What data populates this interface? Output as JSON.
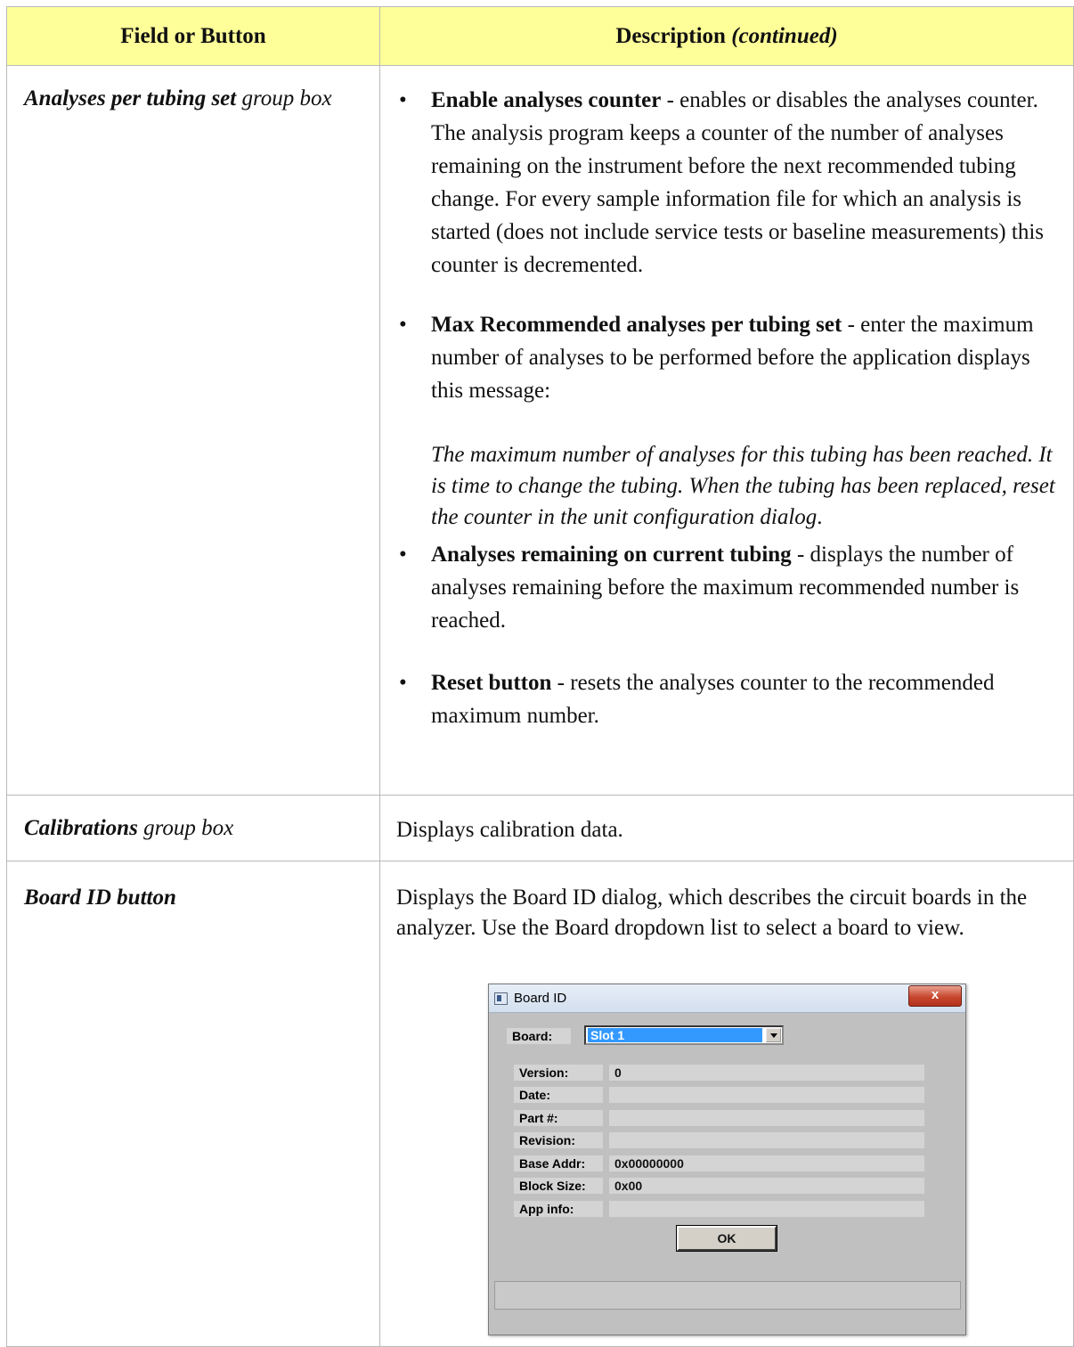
{
  "header": {
    "col1": "Field or Button",
    "col2_main": "Description",
    "col2_note": "(continued)"
  },
  "rows": {
    "analyses": {
      "name_bold": "Analyses per tubing set",
      "name_rest": " group box",
      "bullets": [
        {
          "bold": "Enable analyses counter",
          "text": " - enables or disables the analyses counter. The analysis program keeps a counter of the number of analyses remaining on the instrument before the next recommended tubing change. For every sample information file for which an analysis is started (does not include service tests or baseline measurements) this counter is decremented."
        },
        {
          "bold": "Max Recommended analyses per tubing set",
          "text": " - enter the maximum number of analyses to be performed before the application displays this message:"
        },
        {
          "bold": "Analyses remaining on current tubing",
          "text": " - displays the number of analyses remaining before the maximum recommended number is reached."
        },
        {
          "bold": "Reset button",
          "text": " - resets the analyses counter to the recommended maximum number."
        }
      ],
      "message_italic": "The maximum number of analyses for this tubing has been reached. It is time to change the tubing. When the tubing has been replaced, reset the counter in the unit configuration dialog",
      "message_end": "."
    },
    "calibrations": {
      "name_bold": "Calibrations",
      "name_rest": " group box",
      "description": "Displays calibration data."
    },
    "boardid": {
      "name_bold": "Board ID button",
      "description": "Displays the Board ID dialog, which describes the circuit boards in the analyzer. Use the Board dropdown list to select a board to view."
    }
  },
  "dialog": {
    "title": "Board ID",
    "close": "x",
    "board_label": "Board:",
    "board_value": "Slot 1",
    "fields": [
      {
        "label": "Version:",
        "value": "0"
      },
      {
        "label": "Date:",
        "value": ""
      },
      {
        "label": "Part #:",
        "value": ""
      },
      {
        "label": "Revision:",
        "value": ""
      },
      {
        "label": "Base Addr:",
        "value": "0x00000000"
      },
      {
        "label": "Block Size:",
        "value": "0x00"
      },
      {
        "label": "App info:",
        "value": ""
      }
    ],
    "ok": "OK"
  }
}
